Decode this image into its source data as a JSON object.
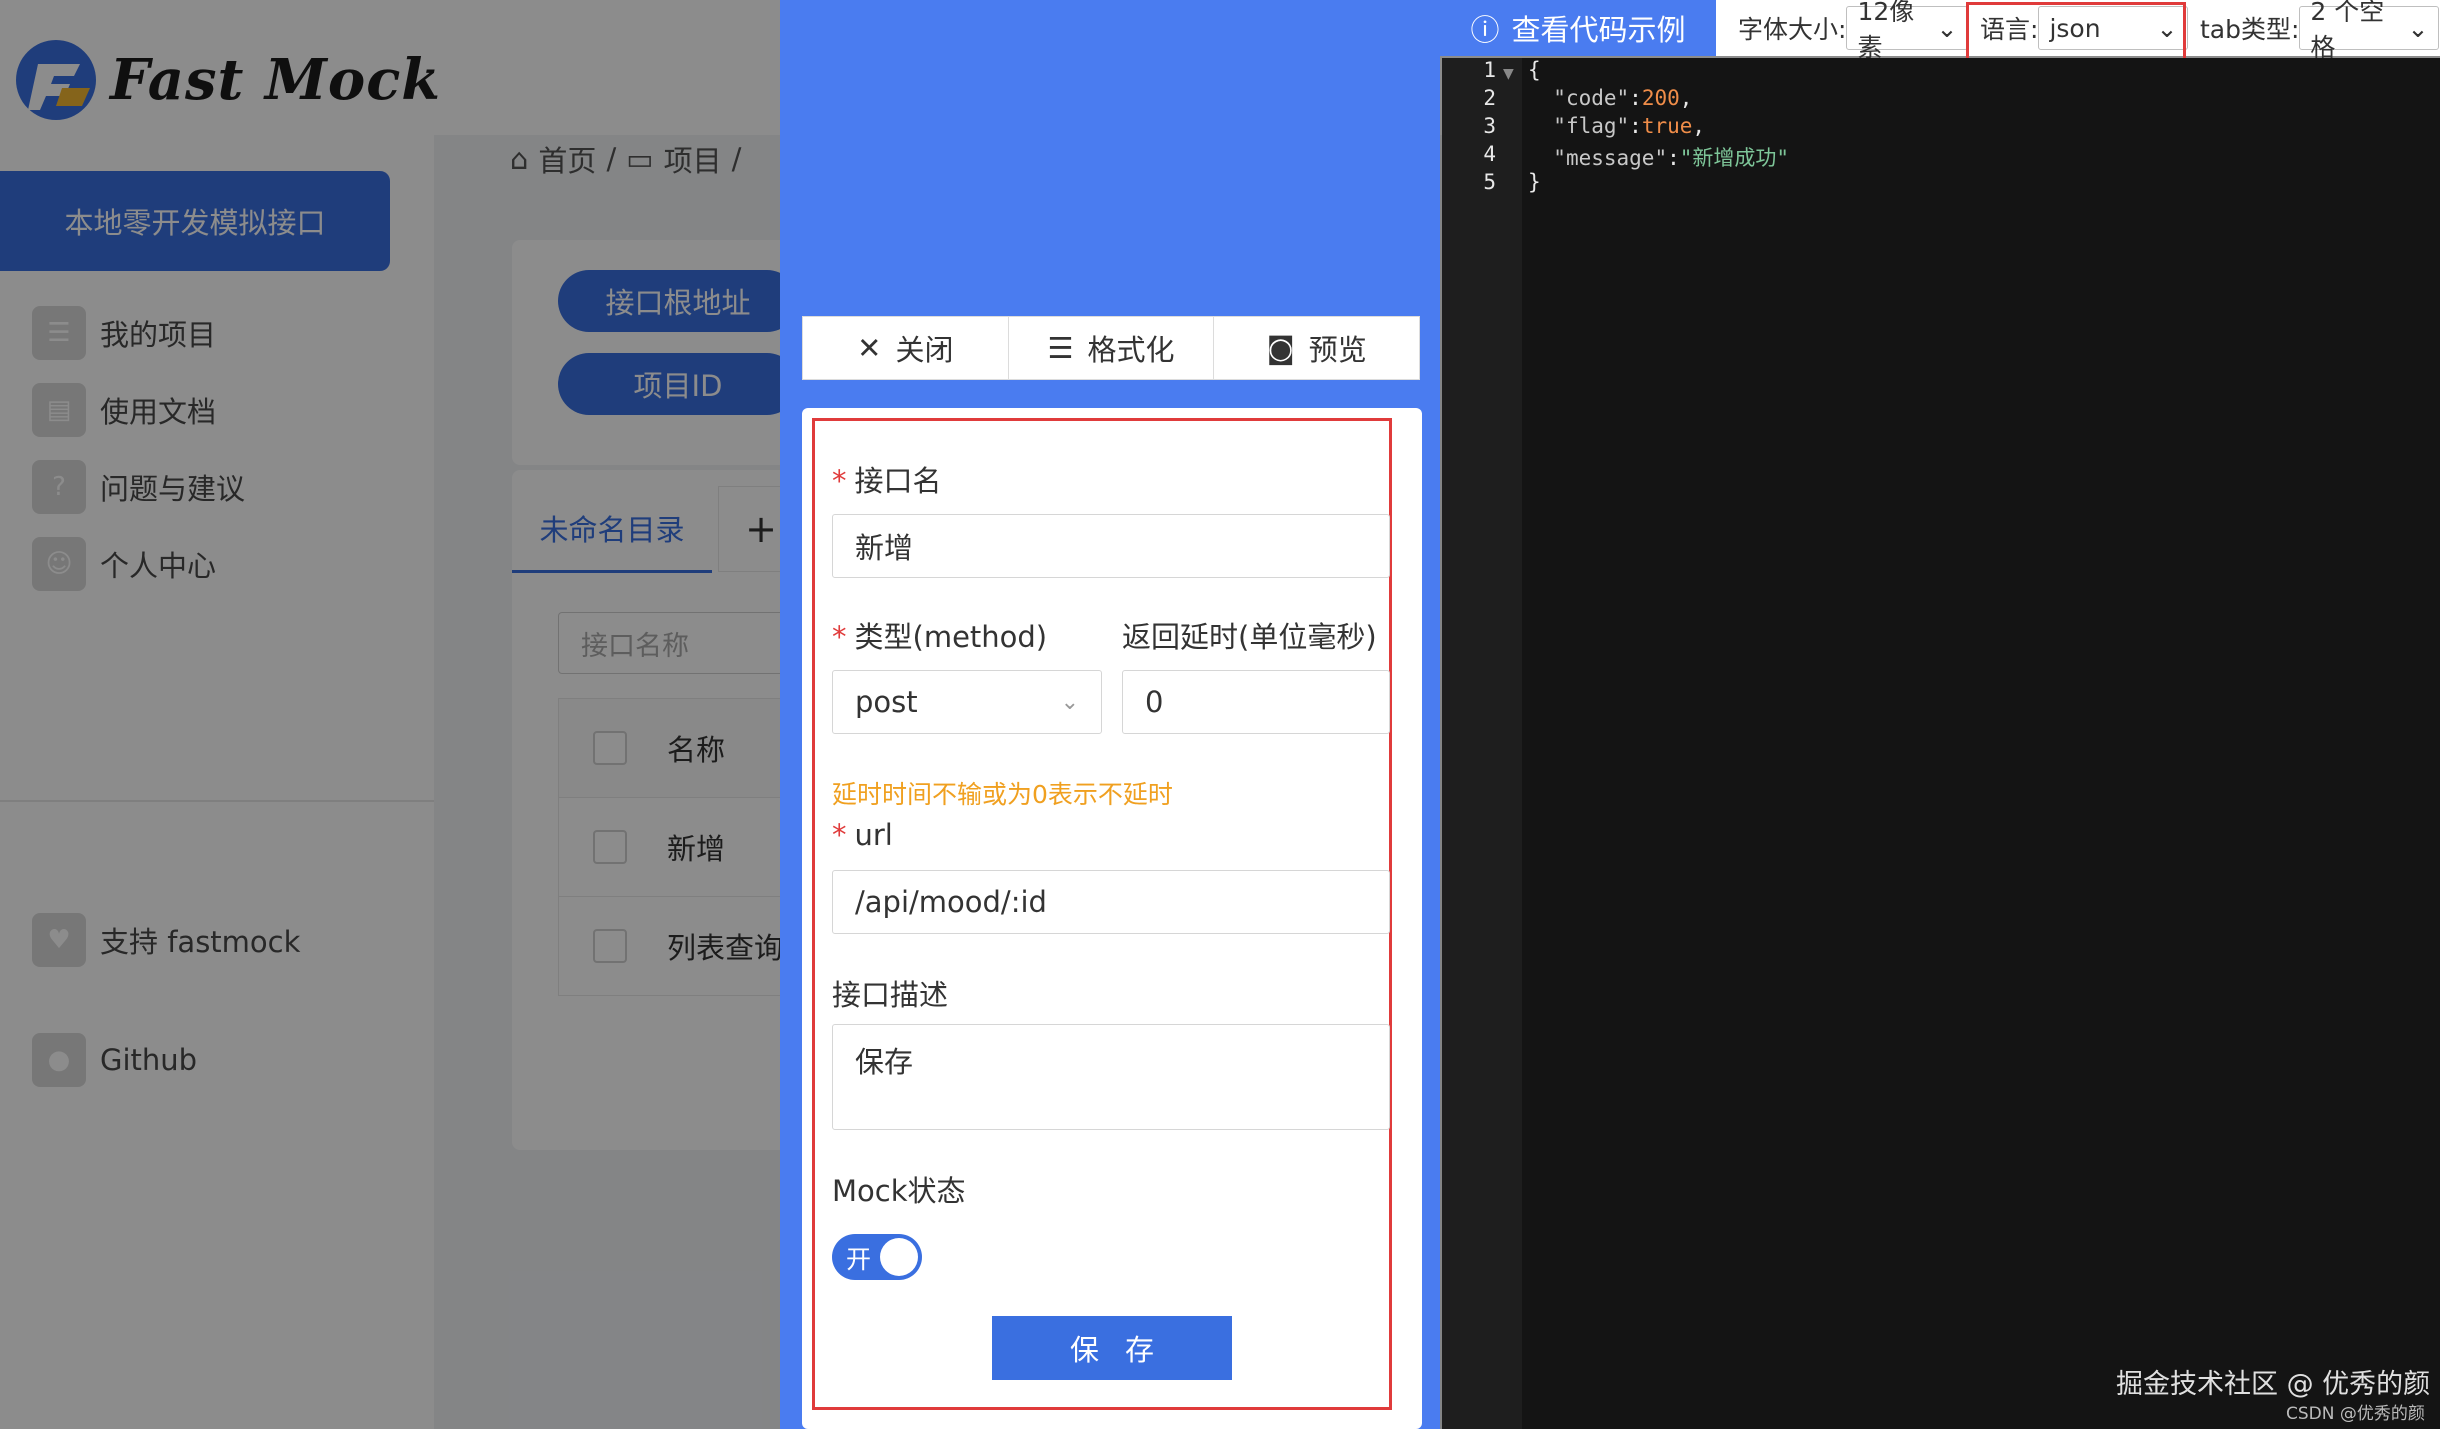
{
  "app": {
    "logo_text": "Fast Mock",
    "tagline": "本地零开发模拟接口"
  },
  "sidebar": {
    "items": [
      {
        "label": "我的项目",
        "icon": "list-icon"
      },
      {
        "label": "使用文档",
        "icon": "document-icon"
      },
      {
        "label": "问题与建议",
        "icon": "question-icon"
      },
      {
        "label": "个人中心",
        "icon": "user-icon"
      },
      {
        "label": "支持 fastmock",
        "icon": "heart-icon"
      },
      {
        "label": "Github",
        "icon": "github-icon"
      }
    ]
  },
  "breadcrumb": {
    "home": "首页",
    "sep1": "/",
    "project": "项目",
    "sep2": "/"
  },
  "project_card": {
    "root_url_button": "接口根地址",
    "project_id_button": "项目ID"
  },
  "directory": {
    "tab_label": "未命名目录",
    "add_tab": "+",
    "search_placeholder": "接口名称",
    "table": {
      "header": "名称",
      "rows": [
        "新增",
        "列表查询"
      ]
    }
  },
  "drawer": {
    "toolbar": {
      "close": "关闭",
      "format": "格式化",
      "preview": "预览"
    },
    "form": {
      "api_name_label": "接口名",
      "api_name_value": "新增",
      "method_label": "类型(method)",
      "method_value": "post",
      "delay_label": "返回延时(单位毫秒)",
      "delay_value": "0",
      "delay_hint": "延时时间不输或为0表示不延时",
      "url_label": "url",
      "url_value": "/api/mood/:id",
      "desc_label": "接口描述",
      "desc_value": "保存",
      "mock_status_label": "Mock状态",
      "mock_toggle_text": "开",
      "mock_enabled": true,
      "save_button": "保存"
    }
  },
  "code_panel": {
    "title": "查看代码示例",
    "font_size_label": "字体大小:",
    "font_size_value": "12像素",
    "language_label": "语言:",
    "language_value": "json",
    "tab_type_label": "tab类型:",
    "tab_type_value": "2 个空格",
    "line_numbers": [
      "1",
      "2",
      "3",
      "4",
      "5"
    ],
    "code": {
      "open": "{",
      "code_key": "\"code\"",
      "code_value": "200",
      "flag_key": "\"flag\"",
      "flag_value": "true",
      "message_key": "\"message\"",
      "message_value": "\"新增成功\"",
      "close": "}"
    }
  },
  "watermark": {
    "main": "掘金技术社区 @ 优秀的颜",
    "sub": "CSDN @优秀的颜"
  },
  "colors": {
    "primary": "#3a6fe0",
    "drawer_blue": "#4a7cf0",
    "highlight_red": "#e03b3b",
    "hint_orange": "#f0a020",
    "code_bg": "#141414"
  }
}
